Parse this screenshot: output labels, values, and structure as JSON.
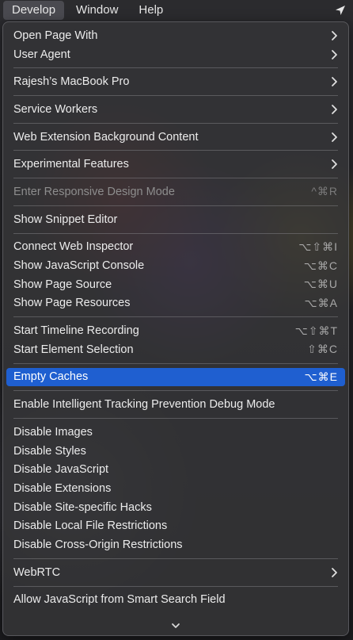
{
  "menubar": {
    "items": [
      "Develop",
      "Window",
      "Help"
    ],
    "location_icon": "location-arrow-icon"
  },
  "menu": {
    "items": [
      {
        "label": "Open Page With",
        "submenu": true
      },
      {
        "label": "User Agent",
        "submenu": true
      },
      {
        "separator": true
      },
      {
        "label": "Rajesh’s MacBook Pro",
        "submenu": true
      },
      {
        "separator": true
      },
      {
        "label": "Service Workers",
        "submenu": true
      },
      {
        "separator": true
      },
      {
        "label": "Web Extension Background Content",
        "submenu": true
      },
      {
        "separator": true
      },
      {
        "label": "Experimental Features",
        "submenu": true
      },
      {
        "separator": true
      },
      {
        "label": "Enter Responsive Design Mode",
        "shortcut": "^⌘R",
        "disabled": true
      },
      {
        "separator": true
      },
      {
        "label": "Show Snippet Editor"
      },
      {
        "separator": true
      },
      {
        "label": "Connect Web Inspector",
        "shortcut": "⌥⇧⌘I"
      },
      {
        "label": "Show JavaScript Console",
        "shortcut": "⌥⌘C"
      },
      {
        "label": "Show Page Source",
        "shortcut": "⌥⌘U"
      },
      {
        "label": "Show Page Resources",
        "shortcut": "⌥⌘A"
      },
      {
        "separator": true
      },
      {
        "label": "Start Timeline Recording",
        "shortcut": "⌥⇧⌘T"
      },
      {
        "label": "Start Element Selection",
        "shortcut": "⇧⌘C"
      },
      {
        "separator": true
      },
      {
        "label": "Empty Caches",
        "shortcut": "⌥⌘E",
        "selected": true
      },
      {
        "separator": true
      },
      {
        "label": "Enable Intelligent Tracking Prevention Debug Mode"
      },
      {
        "separator": true
      },
      {
        "label": "Disable Images"
      },
      {
        "label": "Disable Styles"
      },
      {
        "label": "Disable JavaScript"
      },
      {
        "label": "Disable Extensions"
      },
      {
        "label": "Disable Site-specific Hacks"
      },
      {
        "label": "Disable Local File Restrictions"
      },
      {
        "label": "Disable Cross-Origin Restrictions"
      },
      {
        "separator": true
      },
      {
        "label": "WebRTC",
        "submenu": true
      },
      {
        "separator": true
      },
      {
        "label": "Allow JavaScript from Smart Search Field"
      }
    ],
    "scroll_indicator": "chevron-down-icon"
  },
  "colors": {
    "selection": "#1f5fd0",
    "menu_bg": "#343437",
    "text": "#ececec",
    "disabled_text": "#8d8d8d"
  }
}
